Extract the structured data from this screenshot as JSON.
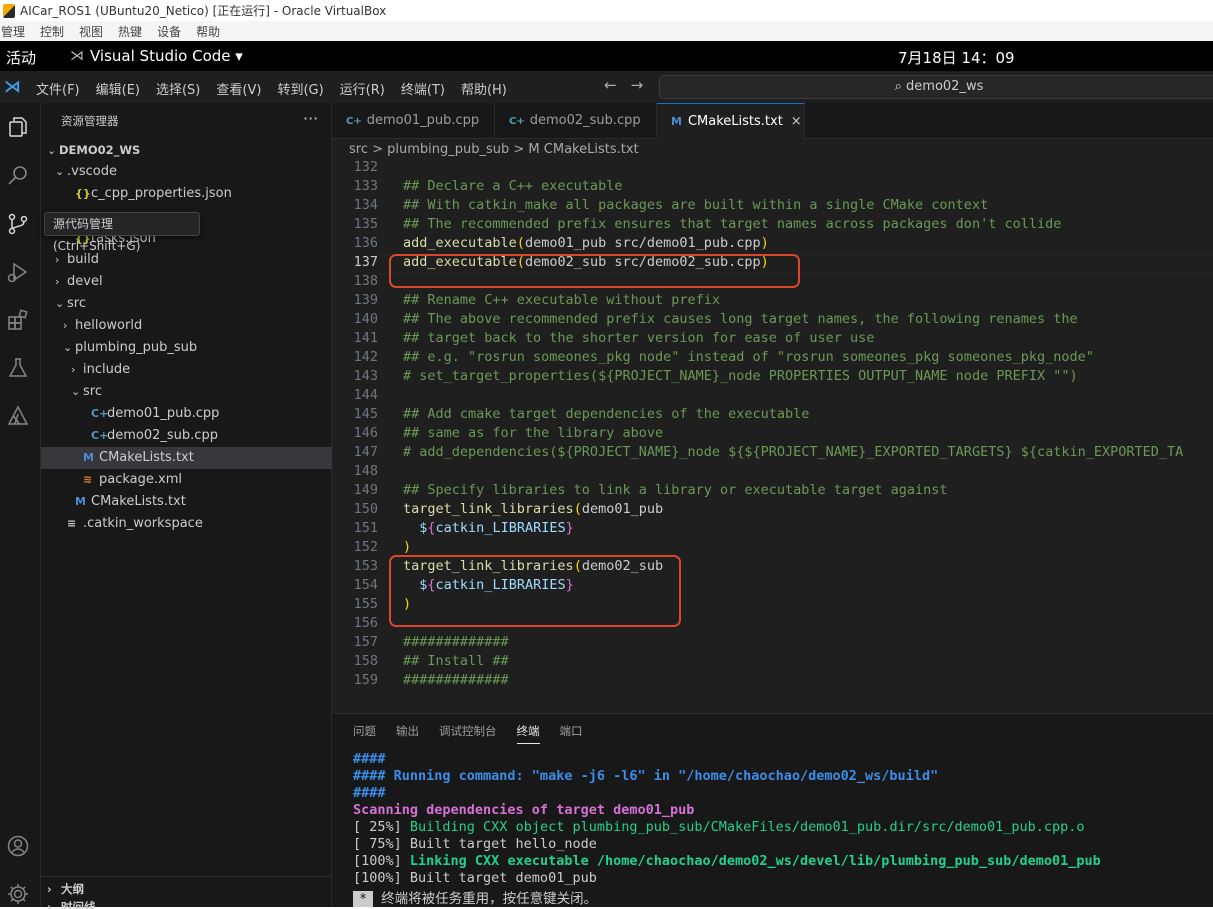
{
  "vbox": {
    "title": "AICar_ROS1 (UBuntu20_Netico) [正在运行] - Oracle VirtualBox",
    "menu": [
      "管理",
      "控制",
      "视图",
      "热键",
      "设备",
      "帮助"
    ]
  },
  "gnome": {
    "activities": "活动",
    "app_name": "Visual Studio Code ▾",
    "clock": "7月18日  14：09"
  },
  "vscode": {
    "menu": [
      "文件(F)",
      "编辑(E)",
      "选择(S)",
      "查看(V)",
      "转到(G)",
      "运行(R)",
      "终端(T)",
      "帮助(H)"
    ],
    "search": "⌕ demo02_ws",
    "icons": [
      "vscode-logo-icon",
      "files-icon",
      "search-icon",
      "source-control-icon",
      "run-debug-icon",
      "extensions-icon",
      "testing-icon",
      "ros-icon",
      "account-icon",
      "settings-gear-icon"
    ]
  },
  "explorer": {
    "header": "资源管理器",
    "more": "···",
    "tooltip": "源代码管理 (Ctrl+Shift+G)",
    "tree": [
      {
        "label": "DEMO02_WS",
        "chev": "⌄",
        "icon": "",
        "kind": "root"
      },
      {
        "label": ".vscode",
        "chev": "⌄",
        "icon": "",
        "kind": "folder"
      },
      {
        "label": "c_cpp_properties.json",
        "chev": "",
        "icon": "{}",
        "kind": "json"
      },
      {
        "label": "tasks.json",
        "chev": "",
        "icon": "{}",
        "kind": "json"
      },
      {
        "label": "build",
        "chev": "›",
        "icon": "",
        "kind": "folder"
      },
      {
        "label": "devel",
        "chev": "›",
        "icon": "",
        "kind": "folder"
      },
      {
        "label": "src",
        "chev": "⌄",
        "icon": "",
        "kind": "folder"
      },
      {
        "label": "helloworld",
        "chev": "›",
        "icon": "",
        "kind": "folder"
      },
      {
        "label": "plumbing_pub_sub",
        "chev": "⌄",
        "icon": "",
        "kind": "folder"
      },
      {
        "label": "include",
        "chev": "›",
        "icon": "",
        "kind": "folder"
      },
      {
        "label": "src",
        "chev": "⌄",
        "icon": "",
        "kind": "folder"
      },
      {
        "label": "demo01_pub.cpp",
        "chev": "",
        "icon": "C+",
        "kind": "cpp"
      },
      {
        "label": "demo02_sub.cpp",
        "chev": "",
        "icon": "C+",
        "kind": "cpp"
      },
      {
        "label": "CMakeLists.txt",
        "chev": "",
        "icon": "M",
        "kind": "cmake"
      },
      {
        "label": "package.xml",
        "chev": "",
        "icon": "≋",
        "kind": "xml"
      },
      {
        "label": "CMakeLists.txt",
        "chev": "",
        "icon": "M",
        "kind": "cmake"
      },
      {
        "label": ".catkin_workspace",
        "chev": "",
        "icon": "≡",
        "kind": "file"
      }
    ],
    "outline": "大纲",
    "timeline": "时间线"
  },
  "tabs": [
    {
      "label": "demo01_pub.cpp",
      "icon": "C+"
    },
    {
      "label": "demo02_sub.cpp",
      "icon": "C+"
    },
    {
      "label": "CMakeLists.txt",
      "icon": "M",
      "close": "×"
    }
  ],
  "breadcrumb": "src  >  plumbing_pub_sub  >  M  CMakeLists.txt",
  "editor": {
    "current_line": 137,
    "lines": [
      {
        "n": 132,
        "t": ""
      },
      {
        "n": 133,
        "t": "## Declare a C++ executable"
      },
      {
        "n": 134,
        "t": "## With catkin_make all packages are built within a single CMake context"
      },
      {
        "n": 135,
        "t": "## The recommended prefix ensures that target names across packages don't collide"
      },
      {
        "n": 136,
        "t": "add_executable(demo01_pub src/demo01_pub.cpp)"
      },
      {
        "n": 137,
        "t": "add_executable(demo02_sub src/demo02_sub.cpp)"
      },
      {
        "n": 138,
        "t": ""
      },
      {
        "n": 139,
        "t": "## Rename C++ executable without prefix"
      },
      {
        "n": 140,
        "t": "## The above recommended prefix causes long target names, the following renames the"
      },
      {
        "n": 141,
        "t": "## target back to the shorter version for ease of user use"
      },
      {
        "n": 142,
        "t": "## e.g. \"rosrun someones_pkg node\" instead of \"rosrun someones_pkg someones_pkg_node\""
      },
      {
        "n": 143,
        "t": "# set_target_properties(${PROJECT_NAME}_node PROPERTIES OUTPUT_NAME node PREFIX \"\")"
      },
      {
        "n": 144,
        "t": ""
      },
      {
        "n": 145,
        "t": "## Add cmake target dependencies of the executable"
      },
      {
        "n": 146,
        "t": "## same as for the library above"
      },
      {
        "n": 147,
        "t": "# add_dependencies(${PROJECT_NAME}_node ${${PROJECT_NAME}_EXPORTED_TARGETS} ${catkin_EXPORTED_TA"
      },
      {
        "n": 148,
        "t": ""
      },
      {
        "n": 149,
        "t": "## Specify libraries to link a library or executable target against"
      },
      {
        "n": 150,
        "t": "target_link_libraries(demo01_pub"
      },
      {
        "n": 151,
        "t": "  ${catkin_LIBRARIES}"
      },
      {
        "n": 152,
        "t": ")"
      },
      {
        "n": 153,
        "t": "target_link_libraries(demo02_sub"
      },
      {
        "n": 154,
        "t": "  ${catkin_LIBRARIES}"
      },
      {
        "n": 155,
        "t": ")"
      },
      {
        "n": 156,
        "t": ""
      },
      {
        "n": 157,
        "t": "#############"
      },
      {
        "n": 158,
        "t": "## Install ##"
      },
      {
        "n": 159,
        "t": "#############"
      }
    ]
  },
  "panel": {
    "tabs": [
      "问题",
      "输出",
      "调试控制台",
      "终端",
      "端口"
    ],
    "active_tab": "终端",
    "lines": [
      [
        {
          "c": "t-blue",
          "t": "####"
        }
      ],
      [
        {
          "c": "t-blue",
          "t": "#### Running command: \"make -j6 -l6\" in \"/home/chaochao/demo02_ws/build\""
        }
      ],
      [
        {
          "c": "t-blue",
          "t": "####"
        }
      ],
      [
        {
          "c": "t-magenta",
          "t": "Scanning dependencies of target demo01_pub"
        }
      ],
      [
        {
          "c": "",
          "t": "[ 25%] "
        },
        {
          "c": "t-green",
          "t": "Building CXX object plumbing_pub_sub/CMakeFiles/demo01_pub.dir/src/demo01_pub.cpp.o"
        }
      ],
      [
        {
          "c": "",
          "t": "[ 75%] Built target hello_node"
        }
      ],
      [
        {
          "c": "",
          "t": "[100%] "
        },
        {
          "c": "t-greenb",
          "t": "Linking CXX executable /home/chaochao/demo02_ws/devel/lib/plumbing_pub_sub/demo01_pub"
        }
      ],
      [
        {
          "c": "",
          "t": "[100%] Built target demo01_pub"
        }
      ],
      [
        {
          "c": "t-star",
          "t": "*"
        },
        {
          "c": "",
          "t": "终端将被任务重用，按任意键关闭。"
        }
      ]
    ]
  }
}
